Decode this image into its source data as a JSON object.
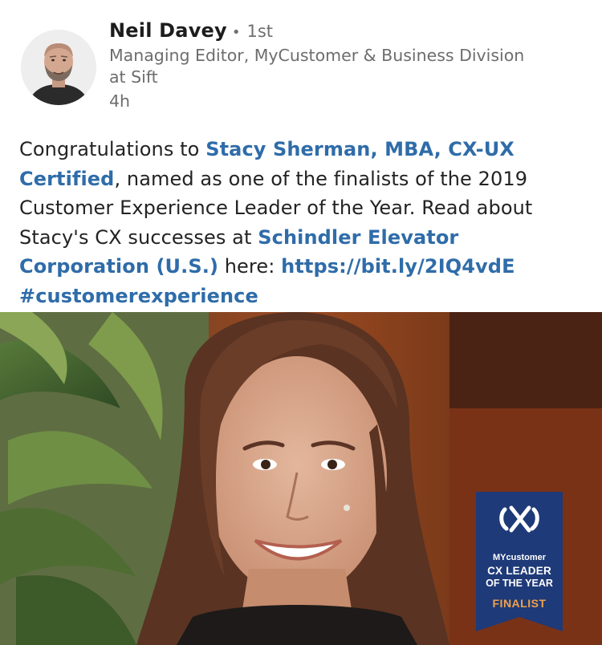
{
  "author": {
    "name": "Neil Davey",
    "degree_separator": "•",
    "degree": "1st",
    "headline": "Managing Editor, MyCustomer & Business Division at Sift",
    "timestamp": "4h"
  },
  "post": {
    "text_intro": "Congratulations to ",
    "mention_person": "Stacy Sherman, MBA, CX-UX Certified",
    "text_middle": ", named as one of the finalists of the 2019 Customer Experience Leader of the Year. Read about Stacy's CX successes at ",
    "mention_company": "Schindler Elevator Corporation (U.S.)",
    "text_here": " here: ",
    "link": "https://bit.ly/2IQ4vdE",
    "hashtag": "#customerexperience"
  },
  "image": {
    "badge": {
      "brand": "MYcustomer",
      "line1": "CX LEADER",
      "line2": "OF THE YEAR",
      "status": "FINALIST"
    }
  },
  "colors": {
    "link": "#2f6ca9",
    "text": "#232323",
    "muted": "#6d6d6d",
    "badge_bg": "#1e3a78",
    "badge_finalist": "#f0a14b"
  }
}
